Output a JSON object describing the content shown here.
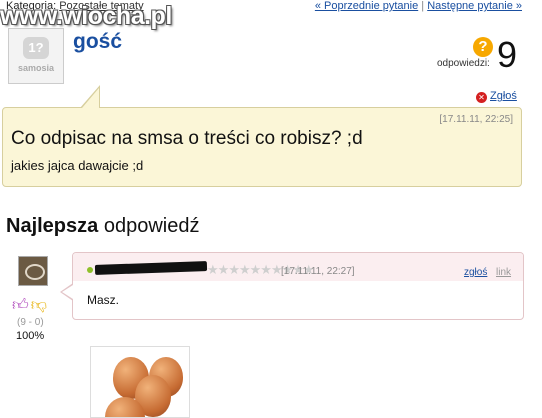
{
  "breadcrumb": {
    "label": "Kategoria:",
    "category": "Pozostałe tematy"
  },
  "watermark": "www.wiocha.pl",
  "nav": {
    "prev": "« Poprzednie pytanie",
    "separator": "|",
    "next": "Następne pytanie »"
  },
  "question": {
    "author": "gość",
    "avatar_text": "samosia",
    "avatar_badge": "1?",
    "answers_label": "odpowiedzi:",
    "answers_count": "9",
    "report_label": "Zgłoś",
    "date": "[17.11.11, 22:25]",
    "title": "Co odpisac na smsa o treści co robisz? ;d",
    "body": "jakies jajca dawajcie ;d"
  },
  "best_answer": {
    "heading_bold": "Najlepsza",
    "heading_rest": " odpowiedź",
    "rating_stars": 10,
    "rating_filled": 0,
    "date": "[17.11.11, 22:27]",
    "report_label": "zgłoś",
    "link_label": "link",
    "text": "Masz.",
    "votes": "(9 - 0)",
    "percent": "100%"
  },
  "colors": {
    "link": "#1a4fa0",
    "question_bg": "#fbf6d7",
    "answer_strip": "#fbeef0"
  },
  "icons": [
    "question-mark-icon",
    "report-x-icon",
    "thumb-up-icon",
    "thumb-down-icon",
    "star-icon"
  ]
}
